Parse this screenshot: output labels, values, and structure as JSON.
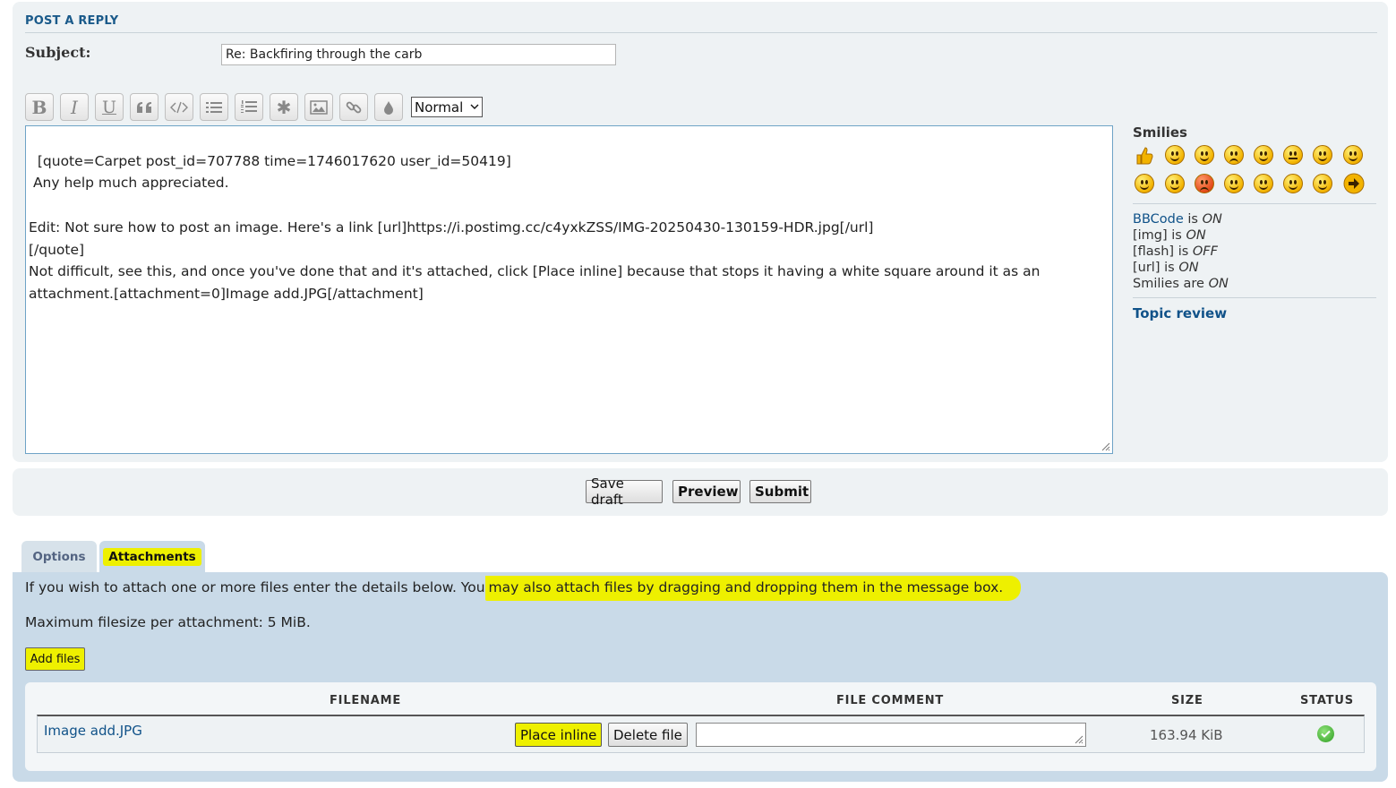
{
  "post": {
    "heading": "POST A REPLY",
    "subject_label": "Subject:",
    "subject_value": "Re: Backfiring through the carb"
  },
  "toolbar": {
    "buttons": [
      "bold-icon",
      "italic-icon",
      "underline-icon",
      "quote-icon",
      "code-icon",
      "list-icon",
      "numbered-list-icon",
      "list-item-icon",
      "image-icon",
      "link-icon",
      "font-color-icon"
    ],
    "font_size": "Normal"
  },
  "message": {
    "text": "[quote=Carpet post_id=707788 time=1746017620 user_id=50419]\n Any help much appreciated.\n\nEdit: Not sure how to post an image. Here's a link [url]https://i.postimg.cc/c4yxkZSS/IMG-20250430-130159-HDR.jpg[/url]\n[/quote]\nNot difficult, see this, and once you've done that and it's attached, click [Place inline] because that stops it having a white square around it as an attachment.[attachment=0]Image add.JPG[/attachment]"
  },
  "sidebar": {
    "smilies_title": "Smilies",
    "bbcode_link": "BBCode",
    "is_word": "is",
    "are_word": "are",
    "bbcode_state": "ON",
    "img_label": "[img]",
    "img_state": "ON",
    "flash_label": "[flash]",
    "flash_state": "OFF",
    "url_label": "[url]",
    "url_state": "ON",
    "smilies_label": "Smilies",
    "smilies_state": "ON",
    "topic_review": "Topic review"
  },
  "actions": {
    "save_draft": "Save draft",
    "preview": "Preview",
    "submit": "Submit"
  },
  "tabs": {
    "options": "Options",
    "attachments": "Attachments"
  },
  "attachments": {
    "intro_part1": "If you wish to attach one or more files enter the details below. You",
    "intro_part2": "may also attach files by dragging and dropping them in the message box.",
    "max_size": "Maximum filesize per attachment: 5 MiB.",
    "add_files": "Add files",
    "columns": {
      "filename": "FILENAME",
      "comment": "FILE COMMENT",
      "size": "SIZE",
      "status": "STATUS"
    },
    "file": {
      "name": "Image add.JPG",
      "place_inline": "Place inline",
      "delete": "Delete file",
      "comment": "",
      "size": "163.94 KiB",
      "status": "uploaded"
    }
  },
  "colors": {
    "highlight": "#eef000",
    "link": "#105289",
    "panel": "#eef2f4",
    "attach_panel": "#c9dae8"
  }
}
